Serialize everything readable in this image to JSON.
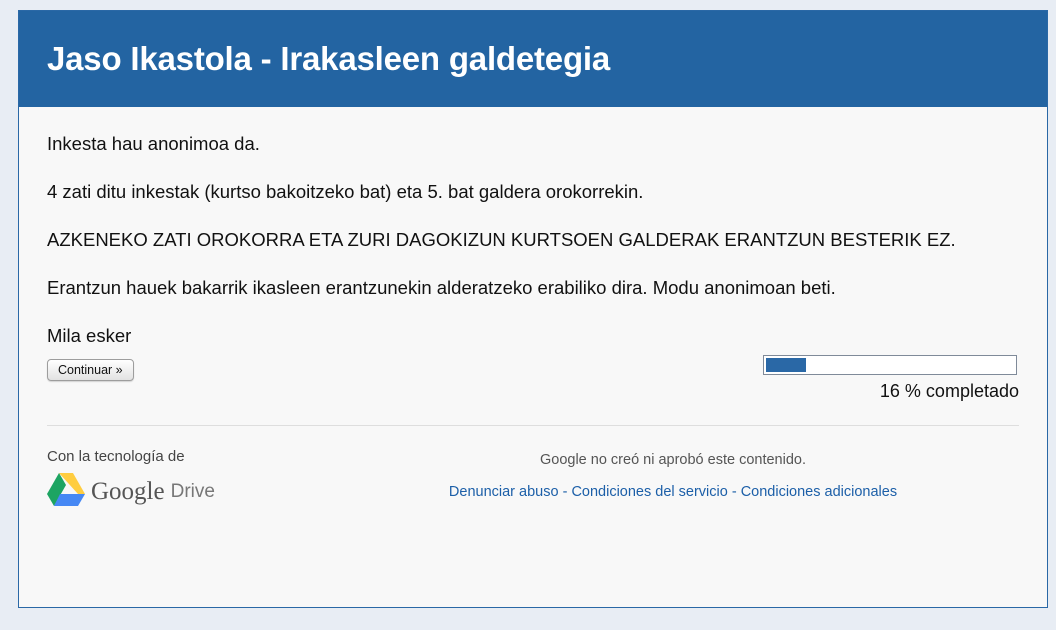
{
  "form": {
    "title": "Jaso Ikastola - Irakasleen galdetegia",
    "description": [
      "Inkesta hau anonimoa da.",
      "4 zati ditu inkestak (kurtso bakoitzeko bat) eta 5. bat galdera orokorrekin.",
      "AZKENEKO ZATI OROKORRA ETA ZURI DAGOKIZUN KURTSOEN GALDERAK ERANTZUN BESTERIK EZ.",
      "Erantzun hauek bakarrik ikasleen erantzunekin alderatzeko erabiliko dira. Modu anonimoan beti.",
      "Mila esker"
    ]
  },
  "navigation": {
    "continue_label": "Continuar »"
  },
  "progress": {
    "percent": 16,
    "label": "16 % completado"
  },
  "footer": {
    "powered_by": "Con la tecnología de",
    "logo_google": "Google",
    "logo_drive": "Drive",
    "disclaimer": "Google no creó ni aprobó este contenido.",
    "links": [
      "Denunciar abuso",
      "Condiciones del servicio",
      "Condiciones adicionales"
    ],
    "link_separator": " - "
  },
  "colors": {
    "header_bg": "#2364a2",
    "progress_fill": "#2a68a6",
    "link": "#1c5fa8",
    "drive_green": "#1da462",
    "drive_yellow": "#ffcd40",
    "drive_blue": "#4688f4"
  }
}
